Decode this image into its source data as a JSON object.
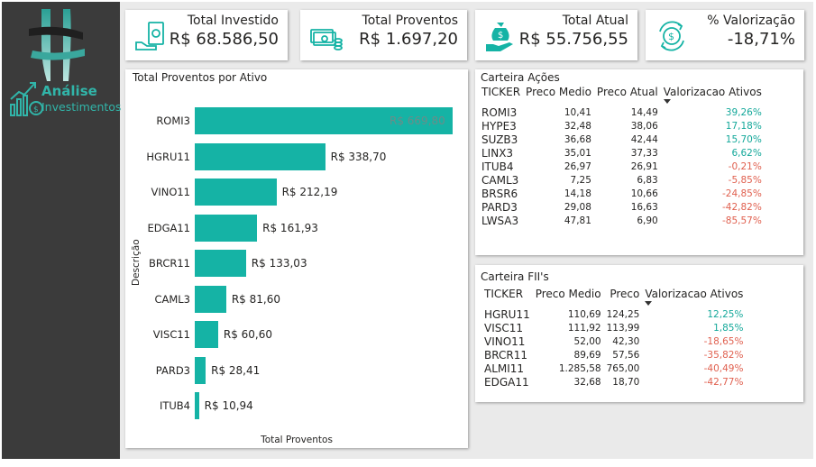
{
  "sidebar": {
    "logo_title": "Análise",
    "logo_subtitle": "Investimentos"
  },
  "kpis": [
    {
      "label": "Total Investido",
      "value": "R$ 68.586,50",
      "icon": "money-hand-icon"
    },
    {
      "label": "Total Proventos",
      "value": "R$ 1.697,20",
      "icon": "cash-coins-icon"
    },
    {
      "label": "Total Atual",
      "value": "R$ 55.756,55",
      "icon": "money-bag-hand-icon"
    },
    {
      "label": "% Valorização",
      "value": "-18,71%",
      "icon": "dollar-cycle-icon"
    }
  ],
  "colors": {
    "accent": "#15b3a5",
    "positive": "#14a89a",
    "negative": "#e0604f",
    "sidebar": "#3b3b3b"
  },
  "chart_data": {
    "type": "bar",
    "orientation": "horizontal",
    "title": "Total Proventos por Ativo",
    "xlabel": "Total Proventos",
    "ylabel": "Descrição",
    "categories": [
      "ROMI3",
      "HGRU11",
      "VINO11",
      "EDGA11",
      "BRCR11",
      "CAML3",
      "VISC11",
      "PARD3",
      "ITUB4"
    ],
    "values": [
      669.8,
      338.7,
      212.19,
      161.93,
      133.03,
      81.6,
      60.6,
      28.41,
      10.94
    ],
    "value_labels": [
      "R$ 669,80",
      "R$ 338,70",
      "R$ 212,19",
      "R$ 161,93",
      "R$ 133,03",
      "R$ 81,60",
      "R$ 60,60",
      "R$ 28,41",
      "R$ 10,94"
    ],
    "xlim": [
      0,
      669.8
    ],
    "grid": false
  },
  "acoes": {
    "title": "Carteira Ações",
    "columns": [
      "TICKER",
      "Preco Medio",
      "Preco Atual",
      "Valorizacao Ativos"
    ],
    "rows": [
      {
        "ticker": "ROMI3",
        "medio": "10,41",
        "atual": "14,49",
        "val": "39,26%",
        "sign": "pos"
      },
      {
        "ticker": "HYPE3",
        "medio": "32,48",
        "atual": "38,06",
        "val": "17,18%",
        "sign": "pos"
      },
      {
        "ticker": "SUZB3",
        "medio": "36,68",
        "atual": "42,44",
        "val": "15,70%",
        "sign": "pos"
      },
      {
        "ticker": "LINX3",
        "medio": "35,01",
        "atual": "37,33",
        "val": "6,62%",
        "sign": "pos"
      },
      {
        "ticker": "ITUB4",
        "medio": "26,97",
        "atual": "26,91",
        "val": "-0,21%",
        "sign": "neg"
      },
      {
        "ticker": "CAML3",
        "medio": "7,25",
        "atual": "6,83",
        "val": "-5,85%",
        "sign": "neg"
      },
      {
        "ticker": "BRSR6",
        "medio": "14,18",
        "atual": "10,66",
        "val": "-24,85%",
        "sign": "neg"
      },
      {
        "ticker": "PARD3",
        "medio": "29,08",
        "atual": "16,63",
        "val": "-42,82%",
        "sign": "neg"
      },
      {
        "ticker": "LWSA3",
        "medio": "47,81",
        "atual": "6,90",
        "val": "-85,57%",
        "sign": "neg"
      }
    ]
  },
  "fiis": {
    "title": "Carteira FII's",
    "columns": [
      "TICKER",
      "Preco Medio",
      "Preco",
      "Valorizacao Ativos"
    ],
    "rows": [
      {
        "ticker": "HGRU11",
        "medio": "110,69",
        "atual": "124,25",
        "val": "12,25%",
        "sign": "pos"
      },
      {
        "ticker": "VISC11",
        "medio": "111,92",
        "atual": "113,99",
        "val": "1,85%",
        "sign": "pos"
      },
      {
        "ticker": "VINO11",
        "medio": "52,00",
        "atual": "42,30",
        "val": "-18,65%",
        "sign": "neg"
      },
      {
        "ticker": "BRCR11",
        "medio": "89,69",
        "atual": "57,56",
        "val": "-35,82%",
        "sign": "neg"
      },
      {
        "ticker": "ALMI11",
        "medio": "1.285,58",
        "atual": "765,00",
        "val": "-40,49%",
        "sign": "neg"
      },
      {
        "ticker": "EDGA11",
        "medio": "32,68",
        "atual": "18,70",
        "val": "-42,77%",
        "sign": "neg"
      }
    ]
  }
}
